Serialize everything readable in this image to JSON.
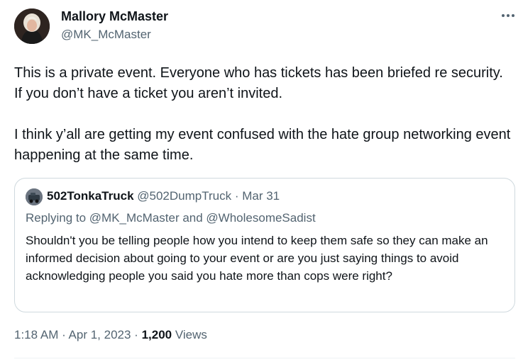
{
  "author": {
    "name": "Mallory McMaster",
    "handle": "@MK_McMaster"
  },
  "tweet": {
    "paragraph1": "This is a private event. Everyone who has tickets has been briefed re security. If you don’t have a ticket you aren’t invited.",
    "paragraph2": "I think y’all are getting my event confused with the hate group networking event happening at the same time."
  },
  "quote": {
    "name": "502TonkaTruck",
    "handle": "@502DumpTruck",
    "separator": " · ",
    "date": "Mar 31",
    "replying_prefix": "Replying to ",
    "reply_mention1": "@MK_McMaster",
    "reply_and": " and ",
    "reply_mention2": "@WholesomeSadist",
    "body": "Shouldn't you be telling people how you intend to keep them safe so they can make an informed decision about going to your event or are you just saying things to avoid acknowledging people you said you hate more than cops were right?"
  },
  "footer": {
    "time": "1:18 AM",
    "dot": " · ",
    "date": "Apr 1, 2023",
    "views_count": "1,200",
    "views_label": " Views"
  },
  "icons": {
    "more": "more-horizontal-icon"
  }
}
